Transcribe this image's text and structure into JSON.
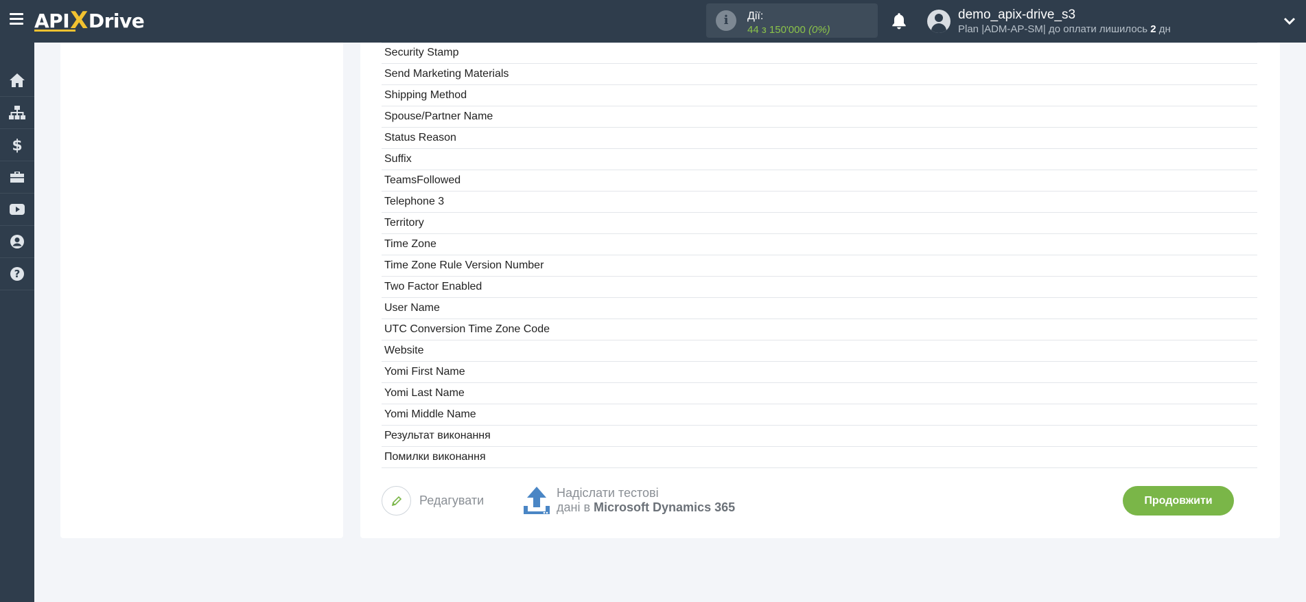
{
  "header": {
    "logo_left": "API",
    "logo_x": "X",
    "logo_right": "Drive",
    "actions_label": "Дії:",
    "actions_count": "44 з 150'000",
    "actions_percent": "(0%)",
    "user_name": "demo_apix-drive_s3",
    "plan_prefix": "Plan |ADM-AP-SM| до оплати лишилось ",
    "plan_days": "2",
    "plan_suffix": " дн"
  },
  "sidebar": {
    "items": [
      {
        "icon": "home-icon"
      },
      {
        "icon": "sitemap-icon"
      },
      {
        "icon": "dollar-icon"
      },
      {
        "icon": "briefcase-icon"
      },
      {
        "icon": "youtube-icon"
      },
      {
        "icon": "user-circle-icon"
      },
      {
        "icon": "question-circle-icon"
      }
    ]
  },
  "fields": [
    "Security Stamp",
    "Send Marketing Materials",
    "Shipping Method",
    "Spouse/Partner Name",
    "Status Reason",
    "Suffix",
    "TeamsFollowed",
    "Telephone 3",
    "Territory",
    "Time Zone",
    "Time Zone Rule Version Number",
    "Two Factor Enabled",
    "User Name",
    "UTC Conversion Time Zone Code",
    "Website",
    "Yomi First Name",
    "Yomi Last Name",
    "Yomi Middle Name",
    "Результат виконання",
    "Помилки виконання"
  ],
  "footer": {
    "edit_label": "Редагувати",
    "send_line1": "Надіслати тестові",
    "send_line2_prefix": "дані в ",
    "send_line2_bold": "Microsoft Dynamics 365",
    "continue_label": "Продовжити"
  },
  "colors": {
    "topbar": "#2f3d4c",
    "accent_green": "#7ab648",
    "logo_yellow": "#f2c230",
    "upload_blue": "#4a86c5"
  }
}
